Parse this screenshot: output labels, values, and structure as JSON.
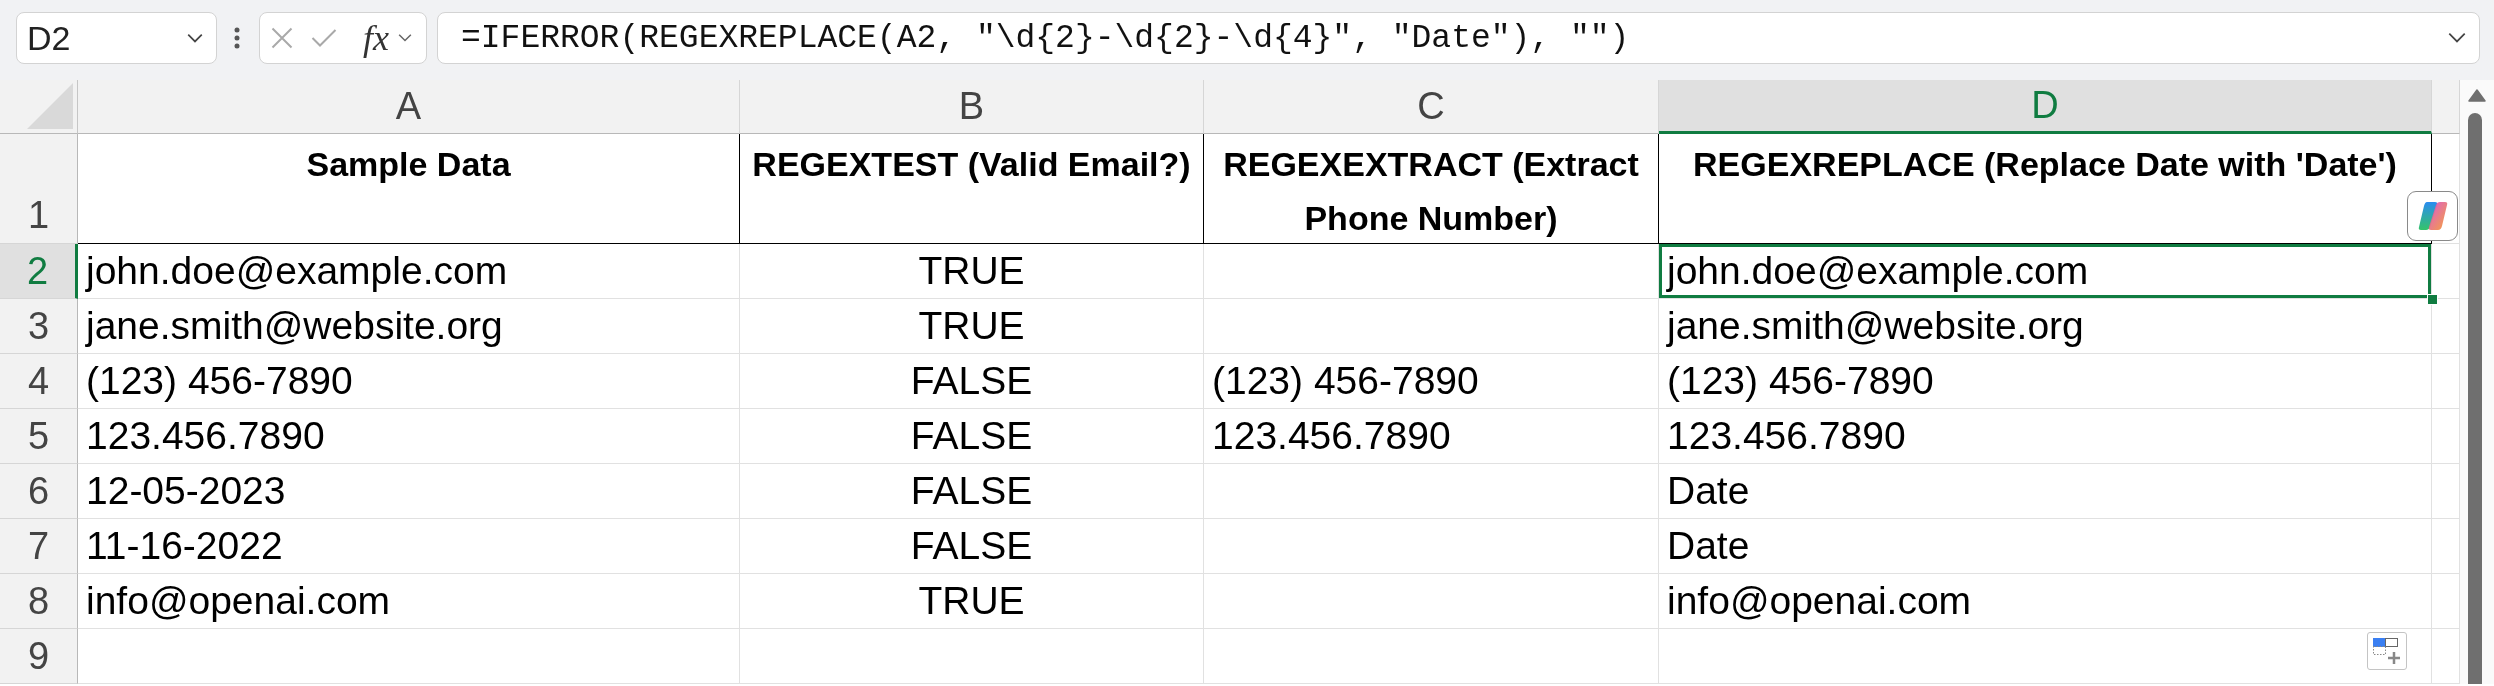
{
  "formula_bar": {
    "name_box": "D2",
    "buttons": [
      {
        "kind": "cancel",
        "disabled": true
      },
      {
        "kind": "enter",
        "disabled": true
      }
    ],
    "function_label": "fx",
    "formula": "=IFERROR(REGEXREPLACE(A2, \"\\d{2}-\\d{2}-\\d{4}\", \"Date\"), \"\")"
  },
  "sheet": {
    "columns": [
      {
        "label": "A",
        "selected": false,
        "kind": "text"
      },
      {
        "label": "B",
        "selected": false,
        "kind": "boolean"
      },
      {
        "label": "C",
        "selected": false,
        "kind": "text"
      },
      {
        "label": "D",
        "selected": true,
        "kind": "text"
      }
    ],
    "rows": [
      {
        "number": "1",
        "kind": "header",
        "selected": false,
        "cells": [
          "Sample Data",
          "REGEXTEST (Valid Email?)",
          "REGEXEXTRACT (Extract Phone Number)",
          "REGEXREPLACE (Replace Date with 'Date')"
        ]
      },
      {
        "number": "2",
        "kind": "data",
        "selected": true,
        "cells": [
          "john.doe@example.com",
          "TRUE",
          null,
          "john.doe@example.com"
        ]
      },
      {
        "number": "3",
        "kind": "data",
        "selected": false,
        "cells": [
          "jane.smith@website.org",
          "TRUE",
          null,
          "jane.smith@website.org"
        ]
      },
      {
        "number": "4",
        "kind": "data",
        "selected": false,
        "cells": [
          "(123) 456-7890",
          "FALSE",
          "(123) 456-7890",
          "(123) 456-7890"
        ]
      },
      {
        "number": "5",
        "kind": "data",
        "selected": false,
        "cells": [
          "123.456.7890",
          "FALSE",
          "123.456.7890",
          "123.456.7890"
        ]
      },
      {
        "number": "6",
        "kind": "data",
        "selected": false,
        "cells": [
          "12-05-2023",
          "FALSE",
          null,
          "Date"
        ]
      },
      {
        "number": "7",
        "kind": "data",
        "selected": false,
        "cells": [
          "11-16-2022",
          "FALSE",
          null,
          "Date"
        ]
      },
      {
        "number": "8",
        "kind": "data",
        "selected": false,
        "cells": [
          "info@openai.com",
          "TRUE",
          null,
          "info@openai.com"
        ]
      },
      {
        "number": "9",
        "kind": "data",
        "selected": false
      }
    ]
  }
}
